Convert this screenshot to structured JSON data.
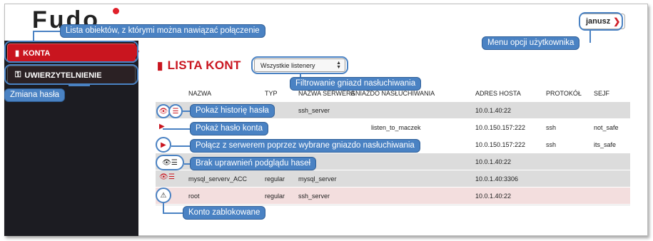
{
  "logo": {
    "text": "Fudo"
  },
  "user_menu": {
    "name": "janusz",
    "chevron": "chevron-down-icon"
  },
  "sidebar": {
    "items": [
      {
        "label": "KONTA",
        "icon": "book-icon",
        "active": true
      },
      {
        "label": "UWIERZYTELNIENIE",
        "icon": "key-icon",
        "active": false
      }
    ]
  },
  "main": {
    "title": "LISTA KONT",
    "filter": {
      "selected": "Wszystkie listenery"
    },
    "columns": [
      "NAZWA",
      "TYP",
      "NAZWA SERWERA",
      "GNIAZDO NASŁUCHIWANIA",
      "ADRES HOSTA",
      "PROTOKÓŁ",
      "SEJF"
    ],
    "rows": [
      {
        "name": "",
        "type": "",
        "server": "ssh_server",
        "listener": "",
        "host": "10.0.1.40:22",
        "protocol": "",
        "safe": ""
      },
      {
        "name": "",
        "type": "",
        "server": "",
        "listener": "listen_to_maczek",
        "host": "10.0.150.157:222",
        "protocol": "ssh",
        "safe": "not_safe"
      },
      {
        "name": "",
        "type": "",
        "server": "",
        "listener": "",
        "host": "10.0.150.157:222",
        "protocol": "ssh",
        "safe": "its_safe"
      },
      {
        "name": "",
        "type": "",
        "server": "",
        "listener": "",
        "host": "10.0.1.40:22",
        "protocol": "",
        "safe": ""
      },
      {
        "name": "mysql_serverv_ACC",
        "type": "regular",
        "server": "mysql_server",
        "listener": "",
        "host": "10.0.1.40:3306",
        "protocol": "",
        "safe": ""
      },
      {
        "name": "root",
        "type": "regular",
        "server": "ssh_server",
        "listener": "",
        "host": "10.0.1.40:22",
        "protocol": "",
        "safe": ""
      }
    ]
  },
  "callouts": {
    "objects_list": "Lista obiektów, z którymi można nawiązać połączenie",
    "user_menu": "Menu opcji użytkownika",
    "filter": "Filtrowanie gniazd nasłuchiwania",
    "change_password": "Zmiana hasła",
    "history": "Pokaż historię hasła",
    "show_password": "Pokaż hasło konta",
    "connect": "Połącz z serwerem poprzez wybrane gniazdo nasłuchiwania",
    "no_permission": "Brak uprawnień podglądu haseł",
    "locked": "Konto zablokowane"
  },
  "colors": {
    "accent": "#c9151f",
    "callout": "#4a82c3",
    "sidebar": "#1c1c22"
  }
}
